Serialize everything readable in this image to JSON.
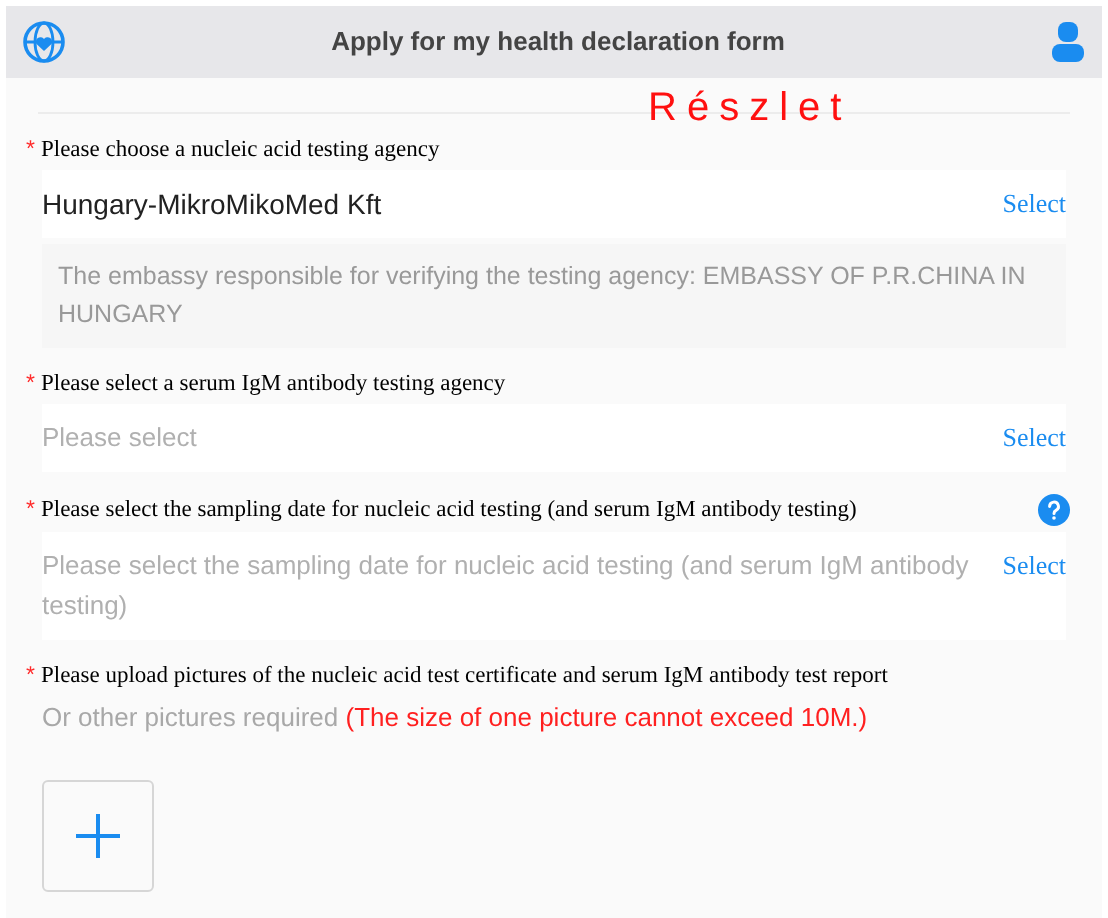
{
  "header": {
    "title": "Apply for my health declaration form"
  },
  "annotation": "Részlet",
  "fields": [
    {
      "kind": "select",
      "required_mark": "*",
      "help": false,
      "label": "Please choose a nucleic acid testing agency",
      "value": "Hungary-MikroMikoMed Kft",
      "action": "Select",
      "note": "The embassy responsible for verifying the testing agency: EMBASSY OF P.R.CHINA IN HUNGARY"
    },
    {
      "kind": "select",
      "required_mark": "*",
      "help": false,
      "label": "Please select a serum IgM antibody testing agency",
      "placeholder": "Please select",
      "action": "Select"
    },
    {
      "kind": "select",
      "required_mark": "*",
      "help": true,
      "label": "Please select the sampling date for nucleic acid testing (and serum IgM antibody testing)",
      "placeholder": "Please select the sampling date for nucleic acid testing (and serum IgM antibody testing)",
      "action": "Select"
    },
    {
      "kind": "upload",
      "required_mark": "*",
      "label": "Please upload pictures of the nucleic acid test certificate and serum IgM antibody test report",
      "hint": "Or other pictures required",
      "warning": "(The size of one picture cannot exceed 10M.)"
    }
  ]
}
